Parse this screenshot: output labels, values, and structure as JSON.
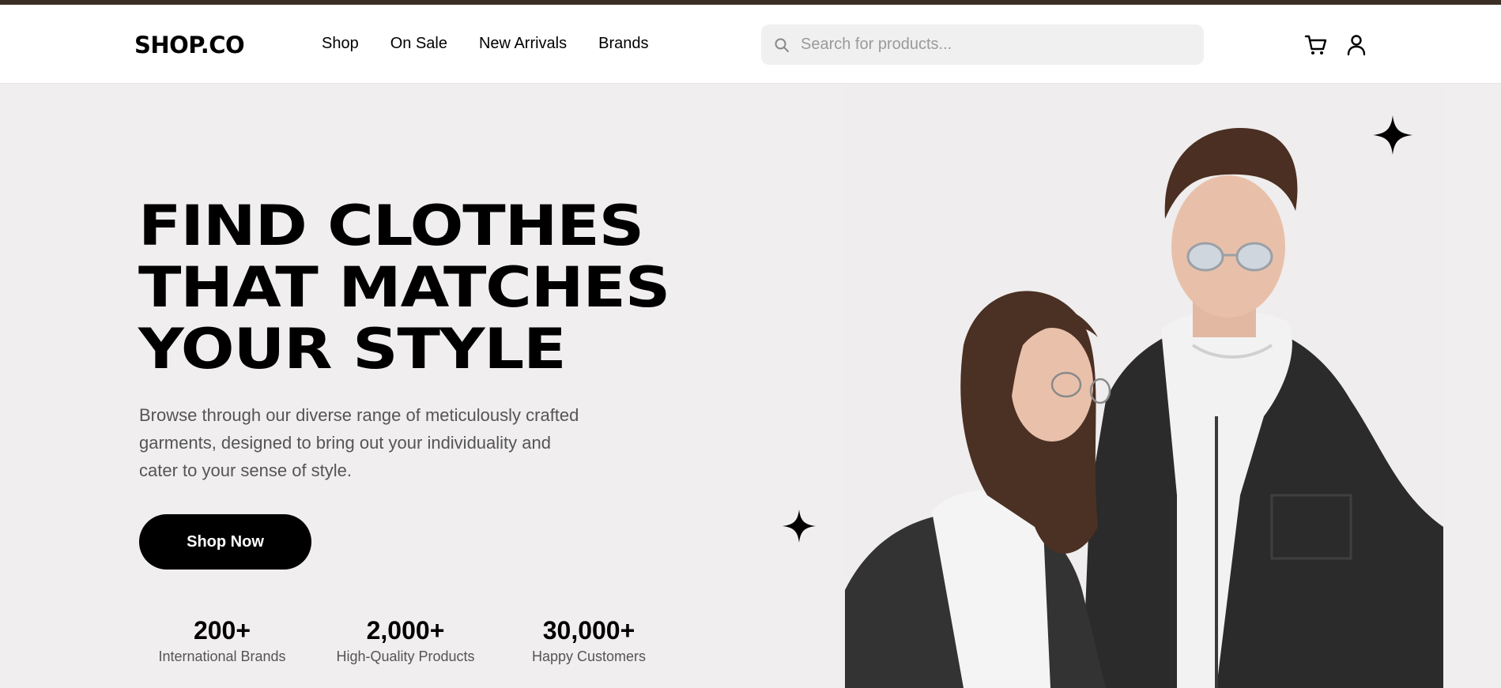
{
  "brand": {
    "logo_text": "SHOP.CO"
  },
  "nav": {
    "items": [
      {
        "label": "Shop"
      },
      {
        "label": "On Sale"
      },
      {
        "label": "New Arrivals"
      },
      {
        "label": "Brands"
      }
    ]
  },
  "search": {
    "placeholder": "Search for products...",
    "value": ""
  },
  "icons": {
    "search": "search-icon",
    "cart": "cart-icon",
    "user": "user-icon",
    "sparkle": "sparkle-icon"
  },
  "hero": {
    "title_lines": [
      "FIND CLOTHES",
      "THAT MATCHES",
      "YOUR STYLE"
    ],
    "description": "Browse through our diverse range of meticulously crafted garments, designed to bring out your individuality and cater to your sense of style.",
    "cta_label": "Shop Now",
    "stats": [
      {
        "value": "200+",
        "label": "International Brands"
      },
      {
        "value": "2,000+",
        "label": "High-Quality Products"
      },
      {
        "value": "30,000+",
        "label": "Happy Customers"
      }
    ]
  },
  "colors": {
    "accent": "#000000",
    "background": "#f0eeef",
    "header_bg": "#ffffff",
    "topbar": "#3b2f25",
    "muted_text": "#555555"
  }
}
